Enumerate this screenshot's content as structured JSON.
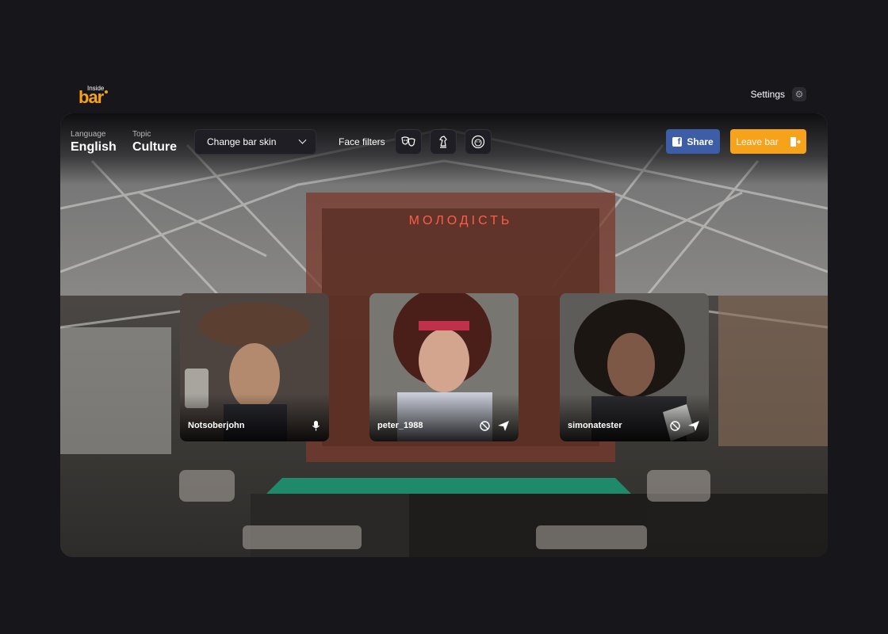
{
  "brand": {
    "small": "Inside",
    "big": "bar"
  },
  "header": {
    "settings_label": "Settings",
    "settings_icon": "gear-icon"
  },
  "room": {
    "language_label": "Language",
    "language_value": "English",
    "topic_label": "Topic",
    "topic_value": "Culture",
    "skin_select": "Change bar skin",
    "face_filters_label": "Face filters",
    "filters": [
      "theater-masks-icon",
      "chess-knight-icon",
      "lion-icon"
    ],
    "share_label": "Share",
    "leave_label": "Leave bar",
    "sign_text": "МОЛОДІСТЬ"
  },
  "participants": [
    {
      "name": "Notsoberjohn",
      "icons": [
        "microphone-icon"
      ]
    },
    {
      "name": "peter_1988",
      "icons": [
        "block-icon",
        "send-icon"
      ]
    },
    {
      "name": "simonatester",
      "icons": [
        "block-icon",
        "send-icon"
      ]
    }
  ],
  "colors": {
    "accent": "#f7a21b",
    "facebook": "#3d5ea6",
    "background": "#17161b"
  }
}
